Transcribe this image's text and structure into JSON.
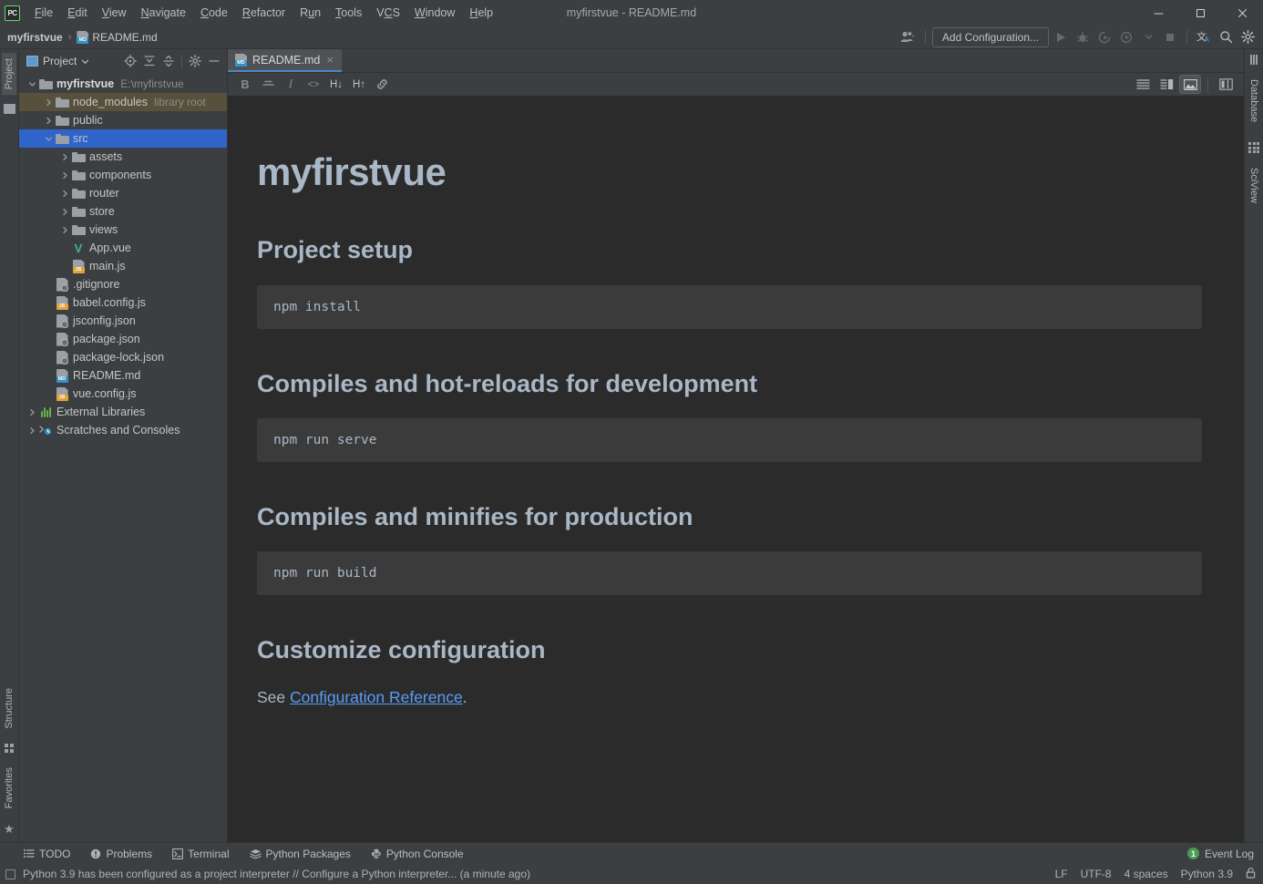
{
  "window": {
    "title": "myfirstvue - README.md",
    "logo_text": "PC",
    "controls": {
      "minimize": "minimize-button",
      "maximize": "maximize-button",
      "close": "close-button"
    }
  },
  "menu": [
    {
      "label": "File"
    },
    {
      "label": "Edit"
    },
    {
      "label": "View"
    },
    {
      "label": "Navigate"
    },
    {
      "label": "Code"
    },
    {
      "label": "Refactor"
    },
    {
      "label": "Run"
    },
    {
      "label": "Tools"
    },
    {
      "label": "VCS"
    },
    {
      "label": "Window"
    },
    {
      "label": "Help"
    }
  ],
  "breadcrumb": {
    "root": "myfirstvue",
    "separator": "›",
    "file": "README.md"
  },
  "toolbar": {
    "add_configuration": "Add Configuration...",
    "icons": [
      "user-avatar-icon",
      "run-icon",
      "debug-icon",
      "run-coverage-icon",
      "profile-icon",
      "dropdown-icon",
      "stop-icon",
      "translate-icon",
      "search-icon",
      "settings-icon"
    ]
  },
  "project_panel": {
    "title": "Project",
    "actions": [
      "select-opened-file-icon",
      "expand-all-icon",
      "collapse-all-icon",
      "settings-icon",
      "hide-icon"
    ],
    "tree": [
      {
        "label": "myfirstvue",
        "sub": "E:\\myfirstvue",
        "indent": 0,
        "arrow": "down",
        "icon": "folder",
        "bold": true
      },
      {
        "label": "node_modules",
        "sub": "library root",
        "indent": 1,
        "arrow": "right",
        "icon": "folder",
        "highlight": "library"
      },
      {
        "label": "public",
        "sub": "",
        "indent": 1,
        "arrow": "right",
        "icon": "folder"
      },
      {
        "label": "src",
        "sub": "",
        "indent": 1,
        "arrow": "down",
        "icon": "folder",
        "selected": true
      },
      {
        "label": "assets",
        "sub": "",
        "indent": 2,
        "arrow": "right",
        "icon": "folder"
      },
      {
        "label": "components",
        "sub": "",
        "indent": 2,
        "arrow": "right",
        "icon": "folder"
      },
      {
        "label": "router",
        "sub": "",
        "indent": 2,
        "arrow": "right",
        "icon": "folder"
      },
      {
        "label": "store",
        "sub": "",
        "indent": 2,
        "arrow": "right",
        "icon": "folder"
      },
      {
        "label": "views",
        "sub": "",
        "indent": 2,
        "arrow": "right",
        "icon": "folder"
      },
      {
        "label": "App.vue",
        "sub": "",
        "indent": 2,
        "arrow": "none",
        "icon": "vue"
      },
      {
        "label": "main.js",
        "sub": "",
        "indent": 2,
        "arrow": "none",
        "icon": "js"
      },
      {
        "label": ".gitignore",
        "sub": "",
        "indent": 1,
        "arrow": "none",
        "icon": "git"
      },
      {
        "label": "babel.config.js",
        "sub": "",
        "indent": 1,
        "arrow": "none",
        "icon": "js"
      },
      {
        "label": "jsconfig.json",
        "sub": "",
        "indent": 1,
        "arrow": "none",
        "icon": "json"
      },
      {
        "label": "package.json",
        "sub": "",
        "indent": 1,
        "arrow": "none",
        "icon": "json"
      },
      {
        "label": "package-lock.json",
        "sub": "",
        "indent": 1,
        "arrow": "none",
        "icon": "json"
      },
      {
        "label": "README.md",
        "sub": "",
        "indent": 1,
        "arrow": "none",
        "icon": "md"
      },
      {
        "label": "vue.config.js",
        "sub": "",
        "indent": 1,
        "arrow": "none",
        "icon": "js"
      },
      {
        "label": "External Libraries",
        "sub": "",
        "indent": 0,
        "arrow": "right",
        "icon": "lib"
      },
      {
        "label": "Scratches and Consoles",
        "sub": "",
        "indent": 0,
        "arrow": "right",
        "icon": "scratch"
      }
    ]
  },
  "left_rail": [
    {
      "label": "Project",
      "icon": "project-icon",
      "active": true
    },
    {
      "label": "Structure",
      "icon": "structure-icon",
      "active": false
    },
    {
      "label": "Favorites",
      "icon": "star-icon",
      "active": false
    }
  ],
  "right_rail": [
    {
      "label": "Database",
      "icon": "database-icon"
    },
    {
      "label": "SciView",
      "icon": "sciview-icon"
    }
  ],
  "editor": {
    "tab": {
      "label": "README.md",
      "close": "×",
      "icon": "md-file-icon"
    },
    "md_toolbar": [
      {
        "name": "bold-button",
        "glyph": "B"
      },
      {
        "name": "strikethrough-button",
        "glyph": "S"
      },
      {
        "name": "italic-button",
        "glyph": "I"
      },
      {
        "name": "code-button",
        "glyph": "<>"
      },
      {
        "name": "heading-down-button",
        "glyph": "H↓"
      },
      {
        "name": "heading-up-button",
        "glyph": "H↑"
      },
      {
        "name": "link-button",
        "glyph": "link"
      }
    ],
    "view_modes": [
      {
        "name": "editor-only-view",
        "active": false
      },
      {
        "name": "editor-and-preview-view",
        "active": false
      },
      {
        "name": "preview-only-view",
        "active": true
      },
      {
        "name": "toggle-split-layout",
        "active": false
      }
    ]
  },
  "preview": {
    "title": "myfirstvue",
    "sections": [
      {
        "heading": "Project setup",
        "code": "npm install"
      },
      {
        "heading": "Compiles and hot-reloads for development",
        "code": "npm run serve"
      },
      {
        "heading": "Compiles and minifies for production",
        "code": "npm run build"
      }
    ],
    "last_heading": "Customize configuration",
    "paragraph_prefix": "See ",
    "paragraph_link": "Configuration Reference",
    "paragraph_suffix": "."
  },
  "bottom_bar": {
    "items": [
      {
        "label": "TODO",
        "icon": "todo-icon"
      },
      {
        "label": "Problems",
        "icon": "problems-icon"
      },
      {
        "label": "Terminal",
        "icon": "terminal-icon"
      },
      {
        "label": "Python Packages",
        "icon": "packages-icon"
      },
      {
        "label": "Python Console",
        "icon": "python-console-icon"
      }
    ],
    "event_log": {
      "label": "Event Log",
      "count": "1"
    }
  },
  "status_bar": {
    "message": "Python 3.9 has been configured as a project interpreter // Configure a Python interpreter... (a minute ago)",
    "right": [
      "LF",
      "UTF-8",
      "4 spaces",
      "Python 3.9"
    ],
    "lock_icon": "lock-icon"
  },
  "colors": {
    "accent_blue": "#2f65ca",
    "tab_underline": "#4a88c7",
    "link": "#589df6",
    "library_root": "#57503b",
    "event_badge_green": "#499c54",
    "vue_green": "#41b883",
    "md_badge_blue": "#3592c4",
    "js_badge_yellow": "#e2a33c"
  }
}
